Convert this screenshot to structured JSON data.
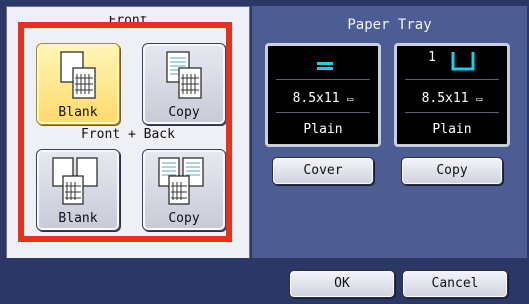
{
  "copy_mode": {
    "front_label": "Front",
    "front_back_label": "Front + Back",
    "front_tiles": [
      {
        "label": "Blank",
        "selected": true
      },
      {
        "label": "Copy",
        "selected": false
      }
    ],
    "front_back_tiles": [
      {
        "label": "Blank",
        "selected": false
      },
      {
        "label": "Copy",
        "selected": false
      }
    ]
  },
  "paper_tray": {
    "title": "Paper Tray",
    "trays": [
      {
        "icon": "paper-stack-icon",
        "number": "",
        "size": "8.5x11",
        "type": "Plain",
        "button": "Cover"
      },
      {
        "icon": "tray-1-icon",
        "number": "1",
        "size": "8.5x11",
        "type": "Plain",
        "button": "Copy"
      }
    ]
  },
  "footer": {
    "ok_label": "OK",
    "cancel_label": "Cancel"
  },
  "colors": {
    "selection_frame": "#e8301c",
    "tray_icon": "#1ad0e8",
    "selected_tile": "#ffd96a"
  }
}
